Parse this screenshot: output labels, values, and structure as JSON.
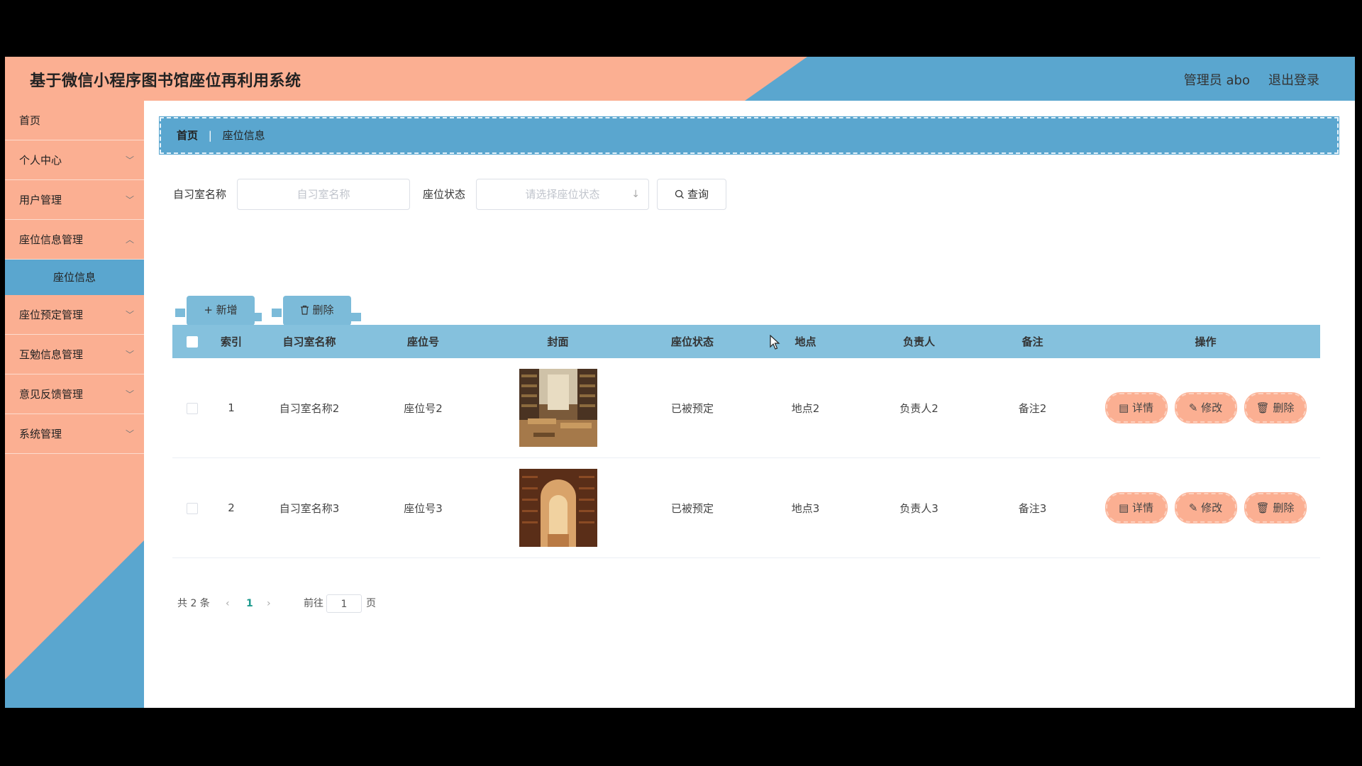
{
  "app_title": "基于微信小程序图书馆座位再利用系统",
  "header": {
    "user": "管理员 abo",
    "logout": "退出登录"
  },
  "sidebar": {
    "items": [
      {
        "label": "首页",
        "has_children": false
      },
      {
        "label": "个人中心",
        "has_children": true
      },
      {
        "label": "用户管理",
        "has_children": true
      },
      {
        "label": "座位信息管理",
        "has_children": true,
        "expanded": true
      },
      {
        "label": "座位预定管理",
        "has_children": true
      },
      {
        "label": "互勉信息管理",
        "has_children": true
      },
      {
        "label": "意见反馈管理",
        "has_children": true
      },
      {
        "label": "系统管理",
        "has_children": true
      }
    ],
    "active_sub": "座位信息"
  },
  "breadcrumb": {
    "home": "首页",
    "separator": "|",
    "current": "座位信息"
  },
  "search": {
    "room_label": "自习室名称",
    "room_placeholder": "自习室名称",
    "status_label": "座位状态",
    "status_placeholder": "请选择座位状态",
    "query_button": "查询"
  },
  "actions": {
    "add": "+ 新增",
    "delete": "删除"
  },
  "table": {
    "headers": [
      "索引",
      "自习室名称",
      "座位号",
      "封面",
      "座位状态",
      "地点",
      "负责人",
      "备注",
      "操作"
    ],
    "rows": [
      {
        "index": "1",
        "room": "自习室名称2",
        "seat": "座位号2",
        "cover": "library-reading-room",
        "status": "已被预定",
        "location": "地点2",
        "owner": "负责人2",
        "note": "备注2"
      },
      {
        "index": "2",
        "room": "自习室名称3",
        "seat": "座位号3",
        "cover": "library-arch-bookshelves",
        "status": "已被预定",
        "location": "地点3",
        "owner": "负责人3",
        "note": "备注3"
      }
    ],
    "row_actions": {
      "detail": "详情",
      "edit": "修改",
      "delete": "删除"
    }
  },
  "pagination": {
    "total": "共 2 条",
    "current_page": "1",
    "goto_label": "前往",
    "goto_value": "1",
    "page_suffix": "页"
  },
  "colors": {
    "salmon": "#fbaf92",
    "blue": "#5aa6cf",
    "table_header": "#85c1dd"
  }
}
